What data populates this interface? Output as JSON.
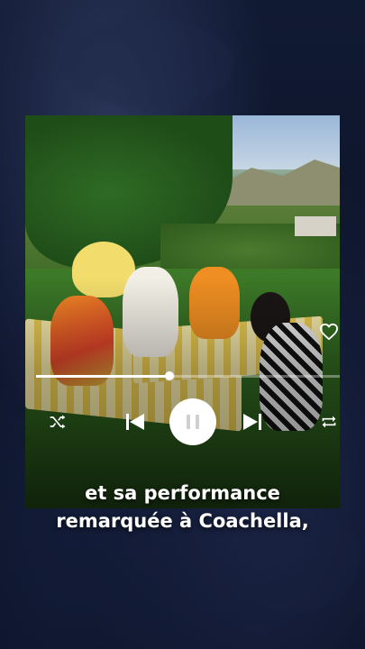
{
  "player": {
    "progress_fraction": 0.44,
    "liked": false
  },
  "caption": {
    "line1": "et sa performance",
    "line2": "remarquée à Coachella,"
  },
  "icons": [
    "heart-icon",
    "shuffle-icon",
    "previous-icon",
    "pause-icon",
    "next-icon",
    "repeat-icon"
  ],
  "colors": {
    "accent": "#ffffff",
    "background": "#0d1428"
  }
}
